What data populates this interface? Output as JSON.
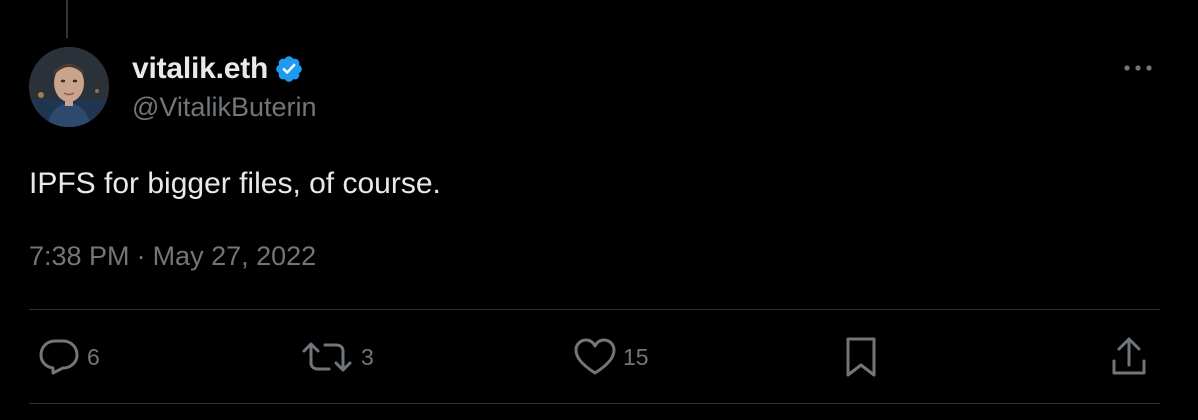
{
  "tweet": {
    "author": {
      "display_name": "vitalik.eth",
      "handle": "@VitalikButerin",
      "verified": true,
      "avatar": "profile-photo"
    },
    "text": "IPFS for bigger files, of course.",
    "time": "7:38 PM",
    "separator": "·",
    "date": "May 27, 2022",
    "more_icon": "more-horizontal-icon"
  },
  "actions": {
    "reply": {
      "icon": "reply-icon",
      "count": "6"
    },
    "retweet": {
      "icon": "retweet-icon",
      "count": "3"
    },
    "like": {
      "icon": "heart-icon",
      "count": "15"
    },
    "bookmark": {
      "icon": "bookmark-icon"
    },
    "share": {
      "icon": "share-icon"
    }
  },
  "colors": {
    "background": "#000000",
    "text_primary": "#e7e9ea",
    "text_secondary": "#71767b",
    "verified_blue": "#1d9bf0",
    "divider": "#2f3336"
  }
}
